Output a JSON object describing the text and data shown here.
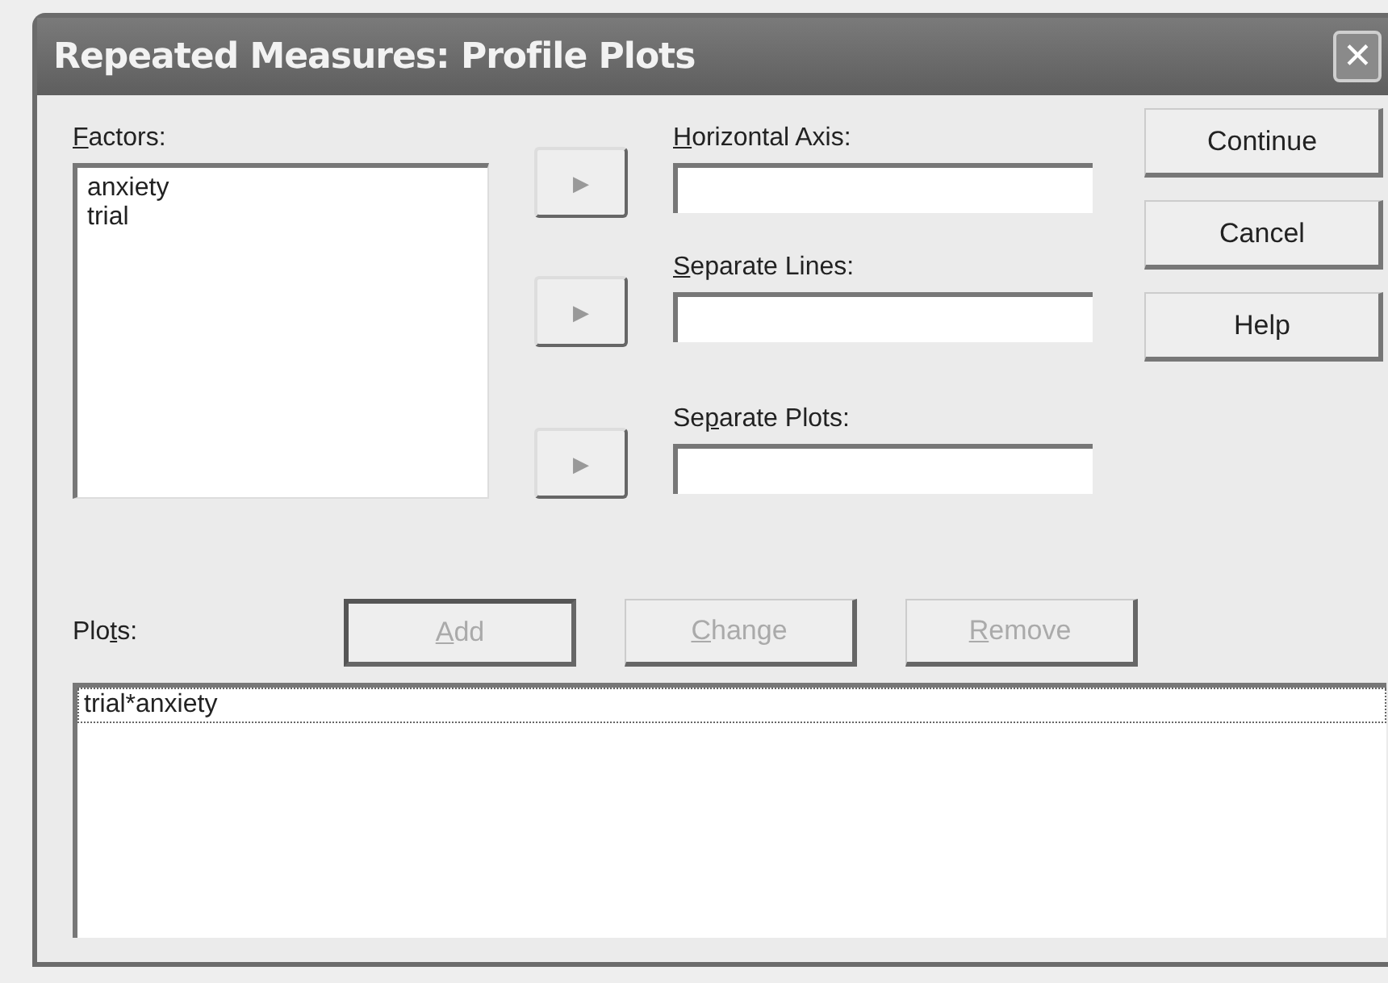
{
  "window": {
    "title": "Repeated Measures: Profile Plots",
    "close": "✕"
  },
  "factors": {
    "label": {
      "key": "F",
      "after": "actors:"
    },
    "items": [
      "anxiety",
      "trial"
    ]
  },
  "targets": [
    {
      "label": {
        "key": "H",
        "after": "orizontal Axis:"
      },
      "arrow": "▶"
    },
    {
      "label": {
        "key": "S",
        "after": "eparate Lines:"
      },
      "arrow": "▶"
    },
    {
      "label": {
        "before": "Se",
        "key": "p",
        "after": "arate Plots:"
      },
      "arrow": "▶"
    }
  ],
  "buttons": [
    "Continue",
    "Cancel",
    "Help"
  ],
  "plots": {
    "label": {
      "before": "Plo",
      "key": "t",
      "after": "s:"
    },
    "actions": [
      {
        "label": {
          "key": "A",
          "after": "dd"
        },
        "disabled": true,
        "default": true
      },
      {
        "label": {
          "key": "C",
          "after": "hange"
        },
        "disabled": true,
        "default": false
      },
      {
        "label": {
          "key": "R",
          "after": "emove"
        },
        "disabled": true,
        "default": false
      }
    ],
    "items": [
      {
        "text": "trial*anxiety",
        "selected": true
      }
    ]
  }
}
